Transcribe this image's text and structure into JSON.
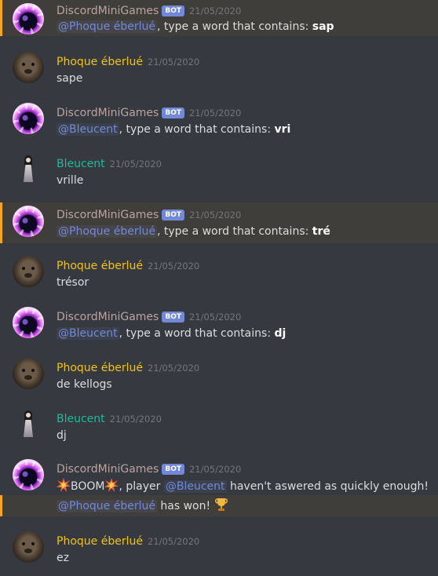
{
  "colors": {
    "background": "#36393f",
    "mention_highlight": "#403e3a",
    "mention_bar": "#faa61a",
    "bot_badge": "#7289da",
    "bot_name": "#b9a4a2",
    "phoque_name": "#f1c40f",
    "bleucent_name": "#1abc9c",
    "mention_text": "#7289da",
    "timestamp": "#72767d"
  },
  "icons": {
    "boom": "collision-emoji",
    "trophy": "trophy-emoji"
  },
  "messages": [
    {
      "author": "DiscordMiniGames",
      "badge": "BOT",
      "time": "21/05/2020",
      "mention": "@Phoque éberlué",
      "text": ", type a word that contains: ",
      "bold": "sap"
    },
    {
      "author": "Phoque éberlué",
      "time": "21/05/2020",
      "text": "sape"
    },
    {
      "author": "DiscordMiniGames",
      "badge": "BOT",
      "time": "21/05/2020",
      "mention": "@Bleucent",
      "text": ", type a word that contains: ",
      "bold": "vri"
    },
    {
      "author": "Bleucent",
      "time": "21/05/2020",
      "text": "vrille"
    },
    {
      "author": "DiscordMiniGames",
      "badge": "BOT",
      "time": "21/05/2020",
      "mention": "@Phoque éberlué",
      "text": ", type a word that contains: ",
      "bold": "tré"
    },
    {
      "author": "Phoque éberlué",
      "time": "21/05/2020",
      "text": "trésor"
    },
    {
      "author": "DiscordMiniGames",
      "badge": "BOT",
      "time": "21/05/2020",
      "mention": "@Bleucent",
      "text": ", type a word that contains: ",
      "bold": "dj"
    },
    {
      "author": "Phoque éberlué",
      "time": "21/05/2020",
      "text": "de kellogs"
    },
    {
      "author": "Bleucent",
      "time": "21/05/2020",
      "text": "dj"
    },
    {
      "author": "DiscordMiniGames",
      "badge": "BOT",
      "time": "21/05/2020",
      "boom_word": "BOOM",
      "text_before_mention": ", player ",
      "mention": "@Bleucent",
      "text_after_mention": " haven't aswered as quickly enough!"
    },
    {
      "mention": "@Phoque éberlué",
      "text": " has won!"
    },
    {
      "author": "Phoque éberlué",
      "time": "21/05/2020",
      "text": "ez"
    }
  ]
}
